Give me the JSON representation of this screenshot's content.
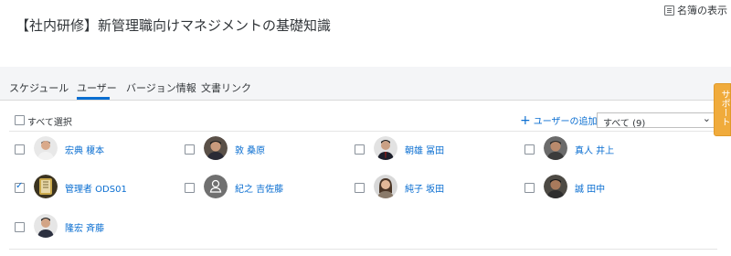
{
  "header": {
    "title": "【社内研修】新管理職向けマネジメントの基礎知識",
    "roster_button": "名簿の表示"
  },
  "tabs": [
    {
      "label": "スケジュール",
      "active": false
    },
    {
      "label": "ユーザー",
      "active": true
    },
    {
      "label": "バージョン情報",
      "active": false
    },
    {
      "label": "文書リンク",
      "active": false
    }
  ],
  "toolbar": {
    "select_all": "すべて選択",
    "add_user": "ユーザーの追加",
    "filter_value": "すべて (9)"
  },
  "users": [
    {
      "name": "宏典 榎本",
      "checked": false,
      "avatar": "photo"
    },
    {
      "name": "敦 桑原",
      "checked": false,
      "avatar": "photo"
    },
    {
      "name": "朝雄 冨田",
      "checked": false,
      "avatar": "photo"
    },
    {
      "name": "真人 井上",
      "checked": false,
      "avatar": "photo"
    },
    {
      "name": "管理者 ODS01",
      "checked": true,
      "avatar": "photo"
    },
    {
      "name": "紀之 吉佐藤",
      "checked": false,
      "avatar": "person-placeholder-icon"
    },
    {
      "name": "純子 坂田",
      "checked": false,
      "avatar": "photo"
    },
    {
      "name": "誠 田中",
      "checked": false,
      "avatar": "photo"
    },
    {
      "name": "隆宏 斉藤",
      "checked": false,
      "avatar": "photo"
    }
  ],
  "support": {
    "label": "サポート",
    "color": "#f0ab3c"
  },
  "colors": {
    "accent": "#0a6ed1",
    "tab_bar": "#f4f5f7"
  }
}
